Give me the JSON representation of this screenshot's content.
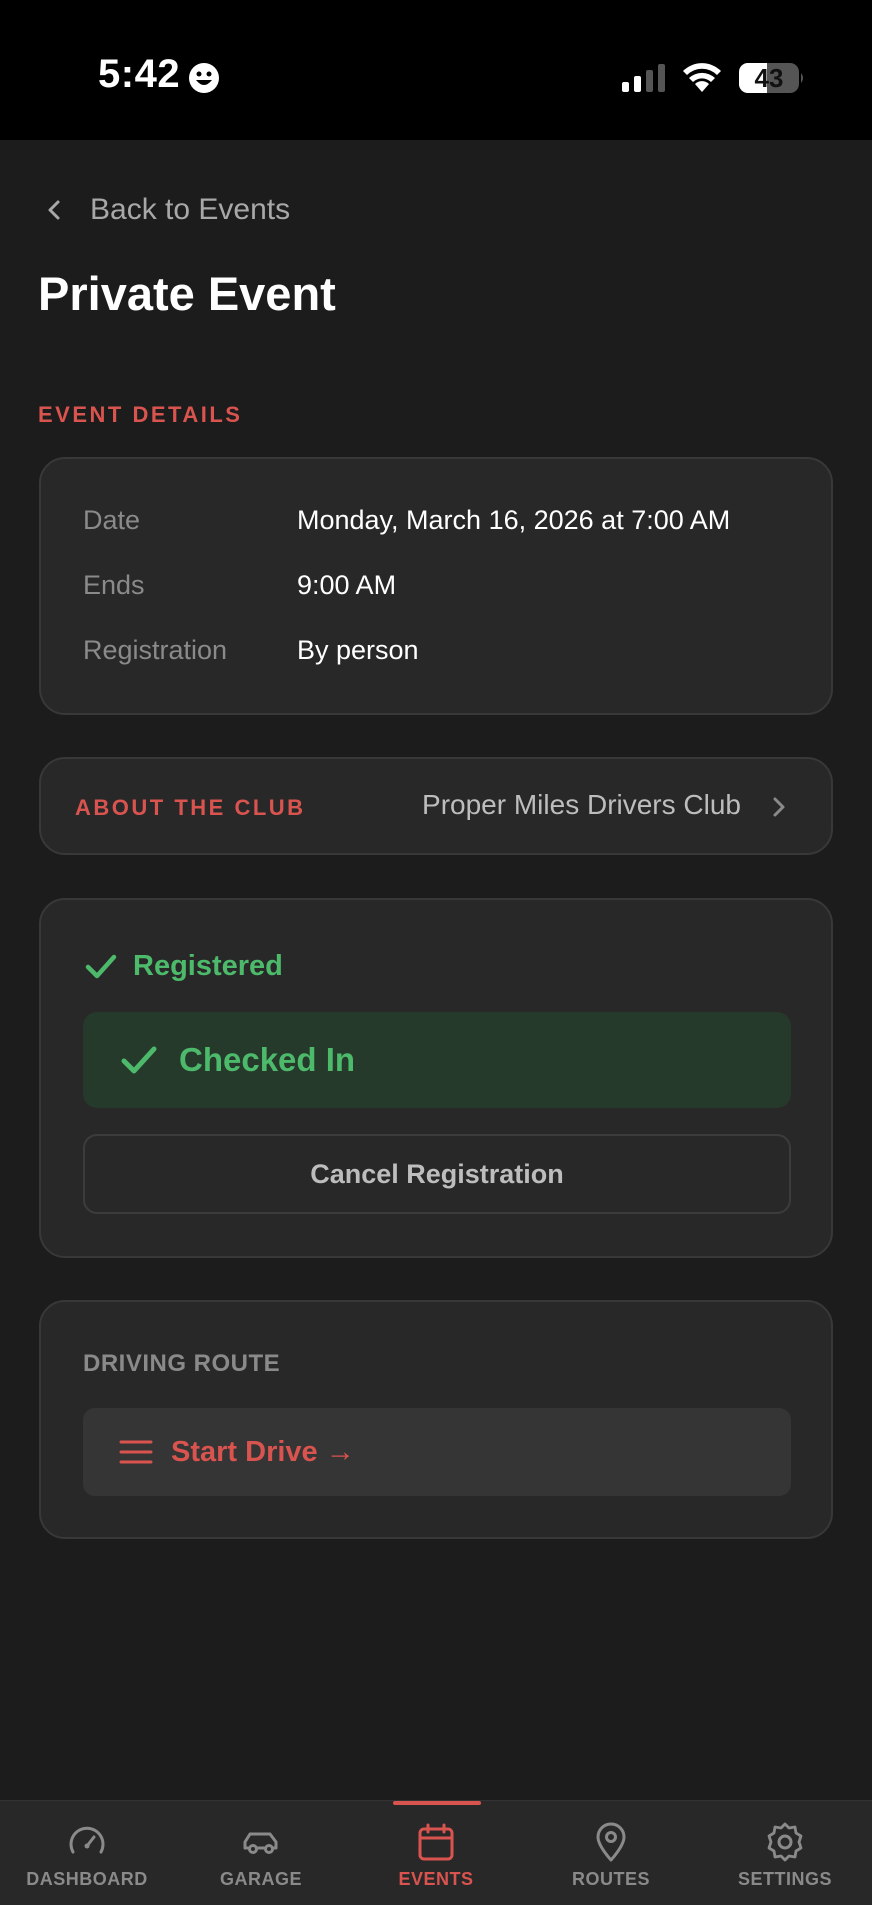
{
  "status_bar": {
    "time": "5:42",
    "battery": "43"
  },
  "nav": {
    "back_label": "Back to Events"
  },
  "page": {
    "title": "Private Event"
  },
  "event_details": {
    "section_label": "EVENT DETAILS",
    "rows": [
      {
        "key": "Date",
        "value": "Monday, March 16, 2026 at 7:00 AM"
      },
      {
        "key": "Ends",
        "value": "9:00 AM"
      },
      {
        "key": "Registration",
        "value": "By person"
      }
    ]
  },
  "club": {
    "label": "ABOUT THE CLUB",
    "name": "Proper Miles Drivers Club"
  },
  "registration": {
    "status": "Registered",
    "checked_in": "Checked In",
    "cancel_label": "Cancel Registration"
  },
  "route": {
    "label": "DRIVING ROUTE",
    "start_label": "Start Drive →"
  },
  "tabs": [
    {
      "label": "DASHBOARD",
      "icon": "speedometer-icon"
    },
    {
      "label": "GARAGE",
      "icon": "car-icon"
    },
    {
      "label": "EVENTS",
      "icon": "calendar-icon",
      "active": true
    },
    {
      "label": "ROUTES",
      "icon": "map-pin-icon"
    },
    {
      "label": "SETTINGS",
      "icon": "gear-icon"
    }
  ],
  "colors": {
    "accent": "#d9534f",
    "success": "#4cba6a",
    "background": "#1c1c1c",
    "card": "#282828"
  }
}
